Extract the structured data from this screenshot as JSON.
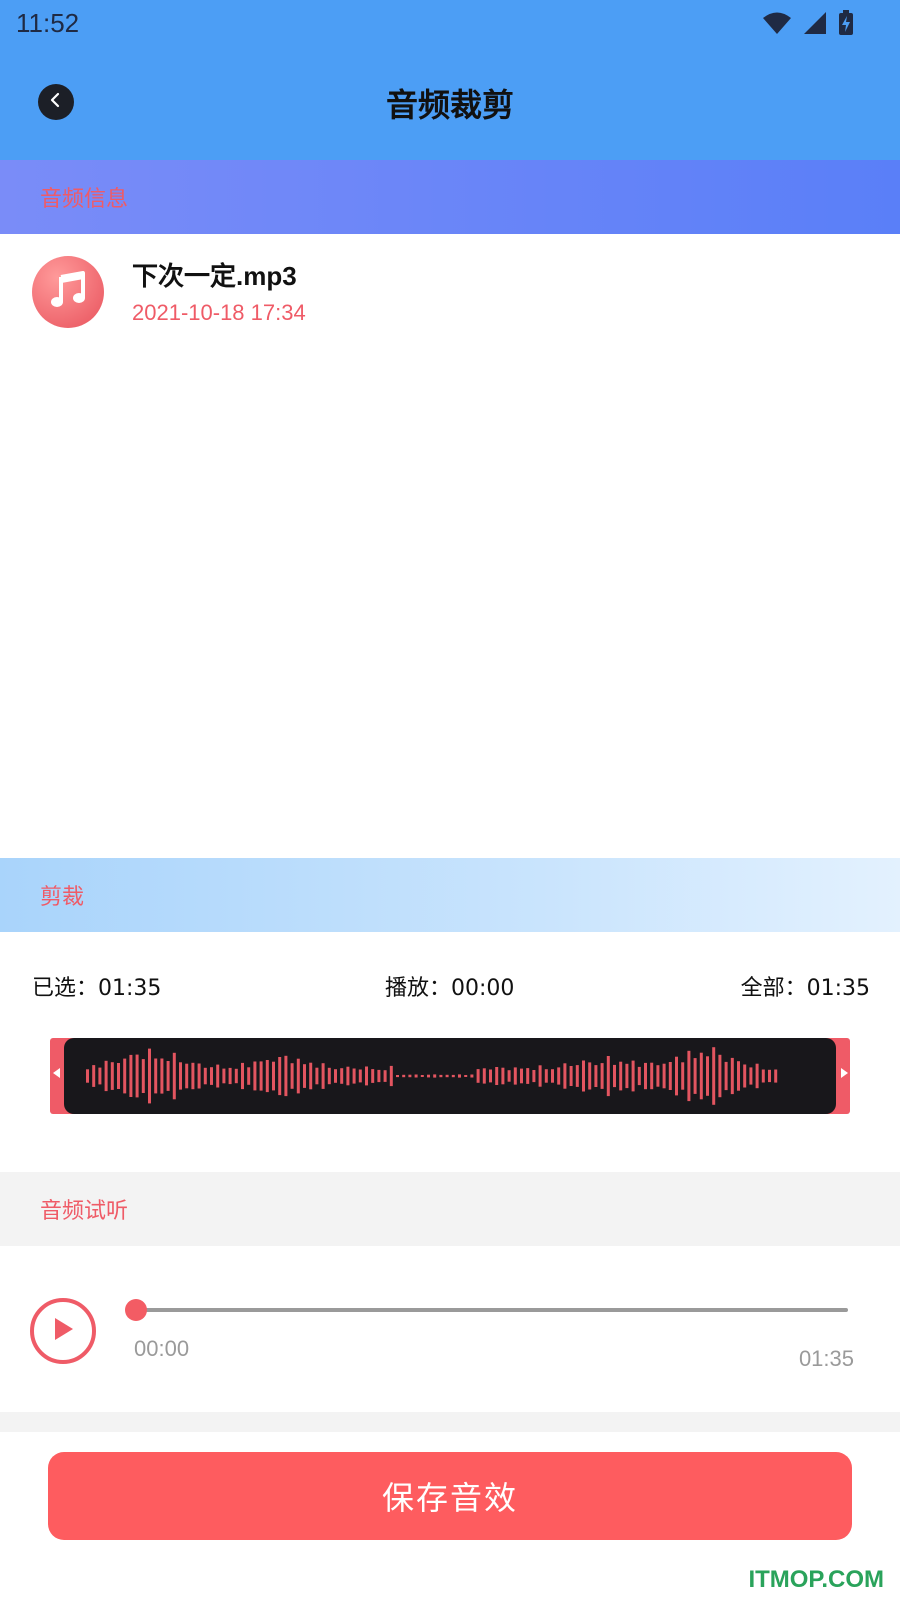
{
  "status_bar": {
    "time": "11:52"
  },
  "header": {
    "title": "音频裁剪"
  },
  "sections": {
    "info": "音频信息",
    "trim": "剪裁",
    "preview": "音频试听"
  },
  "file": {
    "name": "下次一定.mp3",
    "date": "2021-10-18 17:34"
  },
  "trim": {
    "selected": "已选：01:35",
    "playing": "播放：00:00",
    "total": "全部：01:35"
  },
  "player": {
    "current": "00:00",
    "total": "01:35",
    "progress": 0
  },
  "save_button": "保存音效",
  "watermark": "ITMOP.COM",
  "colors": {
    "header": "#4c9ef5",
    "accent": "#ef5b67",
    "save": "#fe5c5f",
    "wave_bg": "#18171b"
  },
  "icons": {
    "back": "chevron-left-icon",
    "file": "music-note-icon",
    "play": "play-icon",
    "wifi": "wifi-icon",
    "signal": "signal-icon",
    "battery": "battery-charging-icon"
  }
}
